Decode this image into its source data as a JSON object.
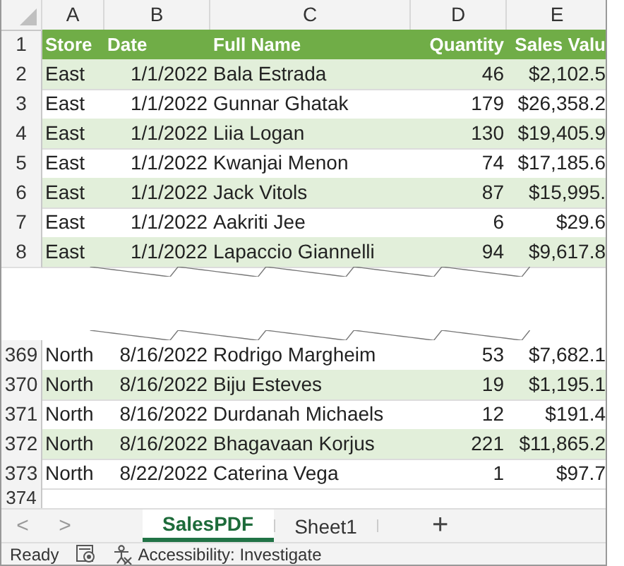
{
  "columns": [
    "A",
    "B",
    "C",
    "D",
    "E"
  ],
  "header_row": {
    "number": "1",
    "cells": [
      "Store",
      "Date",
      "Full Name",
      "Quantity",
      "Sales Valu"
    ]
  },
  "top_rows": [
    {
      "number": "2",
      "cells": [
        "East",
        "1/1/2022",
        "Bala Estrada",
        "46",
        "$2,102.5"
      ]
    },
    {
      "number": "3",
      "cells": [
        "East",
        "1/1/2022",
        "Gunnar Ghatak",
        "179",
        "$26,358.2"
      ]
    },
    {
      "number": "4",
      "cells": [
        "East",
        "1/1/2022",
        "Liia Logan",
        "130",
        "$19,405.9"
      ]
    },
    {
      "number": "5",
      "cells": [
        "East",
        "1/1/2022",
        "Kwanjai Menon",
        "74",
        "$17,185.6"
      ]
    },
    {
      "number": "6",
      "cells": [
        "East",
        "1/1/2022",
        "Jack Vitols",
        "87",
        "$15,995."
      ]
    },
    {
      "number": "7",
      "cells": [
        "East",
        "1/1/2022",
        "Aakriti Jee",
        "6",
        "$29.6"
      ]
    },
    {
      "number": "8",
      "cells": [
        "East",
        "1/1/2022",
        "Lapaccio Giannelli",
        "94",
        "$9,617.8"
      ]
    }
  ],
  "bottom_rows": [
    {
      "number": "369",
      "cells": [
        "North",
        "8/16/2022",
        "Rodrigo Margheim",
        "53",
        "$7,682.1"
      ]
    },
    {
      "number": "370",
      "cells": [
        "North",
        "8/16/2022",
        "Biju Esteves",
        "19",
        "$1,195.1"
      ]
    },
    {
      "number": "371",
      "cells": [
        "North",
        "8/16/2022",
        "Durdanah Michaels",
        "12",
        "$191.4"
      ]
    },
    {
      "number": "372",
      "cells": [
        "North",
        "8/16/2022",
        "Bhagavaan Korjus",
        "221",
        "$11,865.2"
      ]
    },
    {
      "number": "373",
      "cells": [
        "North",
        "8/22/2022",
        "Caterina Vega",
        "1",
        "$97.7"
      ]
    }
  ],
  "empty_row": {
    "number": "374"
  },
  "sheet_tabs": {
    "prev": "<",
    "next": ">",
    "tabs": [
      {
        "label": "SalesPDF",
        "selected": true
      },
      {
        "label": "Sheet1",
        "selected": false
      }
    ],
    "add": "+"
  },
  "status_bar": {
    "mode": "Ready",
    "accessibility": "Accessibility: Investigate"
  }
}
